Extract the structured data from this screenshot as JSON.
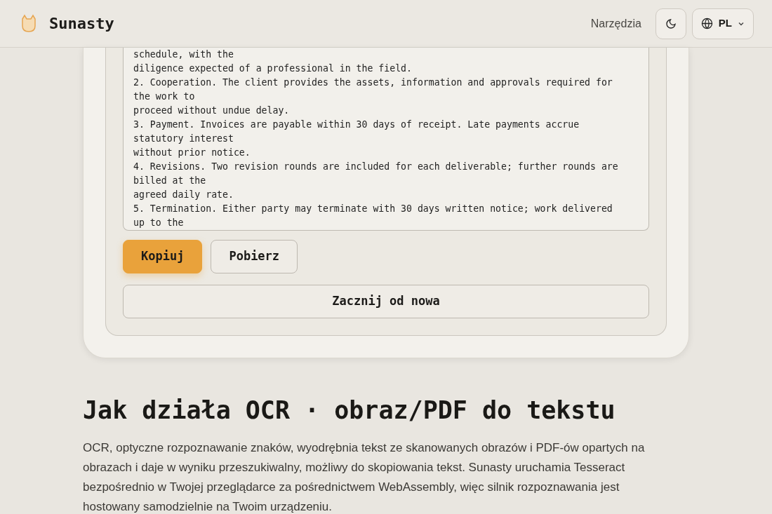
{
  "header": {
    "brand": "Sunasty",
    "nav_link": "Narzędzia",
    "language": "PL"
  },
  "result": {
    "lines": [
      "schedule, with the",
      "diligence expected of a professional in the field.",
      "2. Cooperation. The client provides the assets, information and approvals required for",
      "the work to",
      "proceed without undue delay.",
      "3. Payment. Invoices are payable within 30 days of receipt. Late payments accrue",
      "statutory interest",
      "without prior notice.",
      "4. Revisions. Two revision rounds are included for each deliverable; further rounds are",
      "billed at the",
      "agreed daily rate.",
      "5. Termination. Either party may terminate with 30 days written notice; work delivered",
      "up to the"
    ],
    "actions": [
      {
        "label": "Kopiuj",
        "kind": "primary"
      },
      {
        "label": "Pobierz",
        "kind": "secondary"
      }
    ],
    "restart": "Zacznij od nowa"
  },
  "section": {
    "heading": "Jak działa OCR · obraz/PDF do tekstu",
    "paragraph": "OCR, optyczne rozpoznawanie znaków, wyodrębnia tekst ze skanowanych obrazów i PDF-ów opartych na obrazach i daje w wyniku przeszukiwalny, możliwy do skopiowania tekst. Sunasty uruchamia Tesseract bezpośrednio w Twojej przeglądarce za pośrednictwem WebAssembly, więc silnik rozpoznawania jest hostowany samodzielnie na Twoim urządzeniu."
  }
}
